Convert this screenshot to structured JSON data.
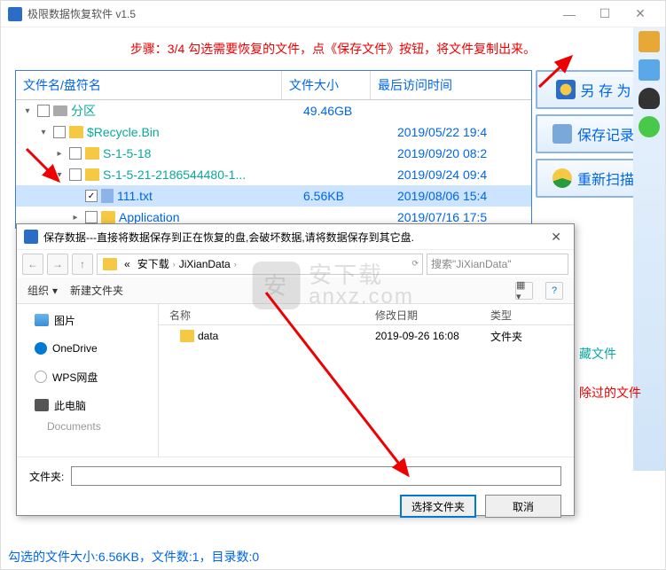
{
  "window": {
    "title": "极限数据恢复软件 v1.5"
  },
  "instruction": "步骤：3/4 勾选需要恢复的文件，点《保存文件》按钮，将文件复制出来。",
  "columns": {
    "name": "文件名/盘符名",
    "size": "文件大小",
    "date": "最后访问时间"
  },
  "tree": [
    {
      "indent": 0,
      "exp": "▾",
      "icon": "drive",
      "label": "分区",
      "size": "49.46GB",
      "date": "",
      "cls": "partition",
      "checked": false
    },
    {
      "indent": 1,
      "exp": "▾",
      "icon": "folder",
      "label": "$Recycle.Bin",
      "size": "",
      "date": "2019/05/22 19:4",
      "cls": "partition",
      "checked": false
    },
    {
      "indent": 2,
      "exp": "▸",
      "icon": "folder",
      "label": "S-1-5-18",
      "size": "",
      "date": "2019/09/20 08:2",
      "cls": "partition",
      "checked": false
    },
    {
      "indent": 2,
      "exp": "▾",
      "icon": "folder",
      "label": "S-1-5-21-2186544480-1...",
      "size": "",
      "date": "2019/09/24 09:4",
      "cls": "partition",
      "checked": false
    },
    {
      "indent": 3,
      "exp": "",
      "icon": "doc",
      "label": "111.txt",
      "size": "6.56KB",
      "date": "2019/08/06 15:4",
      "cls": "file",
      "checked": true,
      "hl": true
    },
    {
      "indent": 3,
      "exp": "▸",
      "icon": "folder",
      "label": "Application",
      "size": "",
      "date": "2019/07/16 17:5",
      "cls": "file",
      "checked": false
    }
  ],
  "side_buttons": {
    "save_as": "另 存 为",
    "save_log": "保存记录",
    "rescan": "重新扫描"
  },
  "dialog": {
    "title": "保存数据---直接将数据保存到正在恢复的盘,会破坏数据,请将数据保存到其它盘.",
    "breadcrumb": [
      "«",
      "安下载",
      "JiXianData"
    ],
    "search_placeholder": "搜索\"JiXianData\"",
    "toolbar": {
      "organize": "组织",
      "new_folder": "新建文件夹"
    },
    "tree_items": [
      "图片",
      "OneDrive",
      "WPS网盘",
      "此电脑",
      "Documents"
    ],
    "list_headers": {
      "name": "名称",
      "date": "修改日期",
      "type": "类型"
    },
    "list_rows": [
      {
        "name": "data",
        "date": "2019-09-26 16:08",
        "type": "文件夹"
      }
    ],
    "folder_label": "文件夹:",
    "btn_select": "选择文件夹",
    "btn_cancel": "取消"
  },
  "extra": {
    "line1": "藏文件",
    "line2": "除过的文件"
  },
  "status": "勾选的文件大小:6.56KB，文件数:1，目录数:0",
  "watermark": "anxz.com"
}
